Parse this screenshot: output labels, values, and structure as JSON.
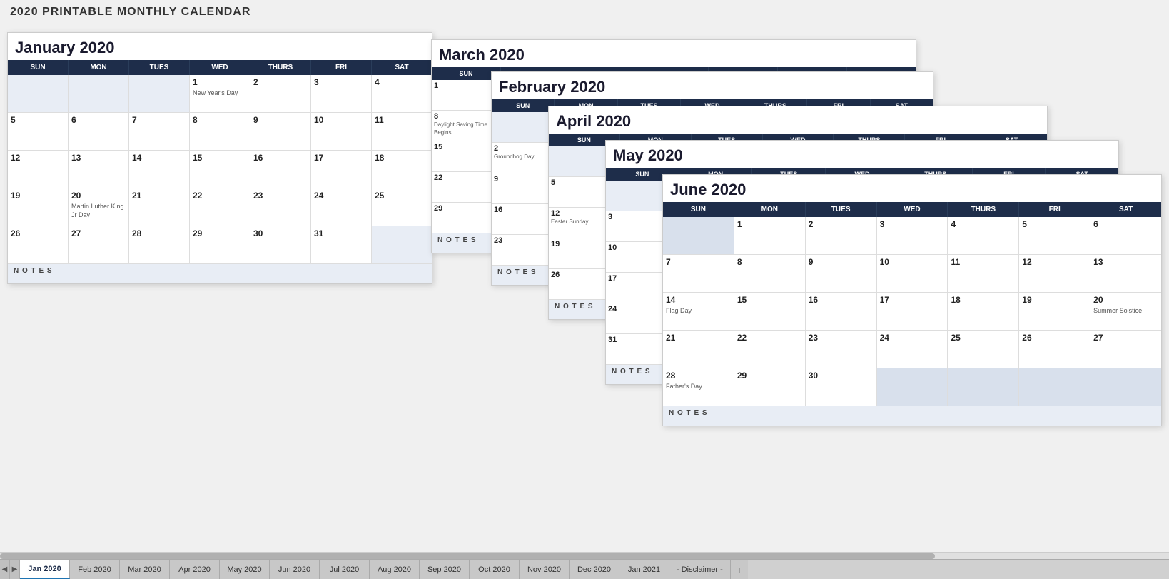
{
  "page": {
    "title": "2020 PRINTABLE MONTHLY CALENDAR"
  },
  "tabs": [
    {
      "label": "Jan 2020",
      "active": true
    },
    {
      "label": "Feb 2020",
      "active": false
    },
    {
      "label": "Mar 2020",
      "active": false
    },
    {
      "label": "Apr 2020",
      "active": false
    },
    {
      "label": "May 2020",
      "active": false
    },
    {
      "label": "Jun 2020",
      "active": false
    },
    {
      "label": "Jul 2020",
      "active": false
    },
    {
      "label": "Aug 2020",
      "active": false
    },
    {
      "label": "Sep 2020",
      "active": false
    },
    {
      "label": "Oct 2020",
      "active": false
    },
    {
      "label": "Nov 2020",
      "active": false
    },
    {
      "label": "Dec 2020",
      "active": false
    },
    {
      "label": "Jan 2021",
      "active": false
    },
    {
      "label": "- Disclaimer -",
      "active": false
    }
  ],
  "january": {
    "title": "January 2020",
    "days": [
      "SUN",
      "MON",
      "TUES",
      "WED",
      "THURS",
      "FRI",
      "SAT"
    ]
  },
  "march": {
    "title": "March 2020",
    "days": [
      "SUN",
      "MON",
      "TUES",
      "WED",
      "THURS",
      "FRI",
      "SAT"
    ]
  },
  "february": {
    "title": "February 2020",
    "days": [
      "SUN",
      "MON",
      "TUES",
      "WED",
      "THURS",
      "FRI",
      "SAT"
    ]
  },
  "april": {
    "title": "April 2020",
    "days": [
      "SUN",
      "MON",
      "TUES",
      "WED",
      "THURS",
      "FRI",
      "SAT"
    ]
  },
  "may": {
    "title": "May 2020",
    "days": [
      "SUN",
      "MON",
      "TUES",
      "WED",
      "THURS",
      "FRI",
      "SAT"
    ]
  },
  "june": {
    "title": "June 2020",
    "days": [
      "SUN",
      "MON",
      "TUES",
      "WED",
      "THURS",
      "FRI",
      "SAT"
    ]
  }
}
